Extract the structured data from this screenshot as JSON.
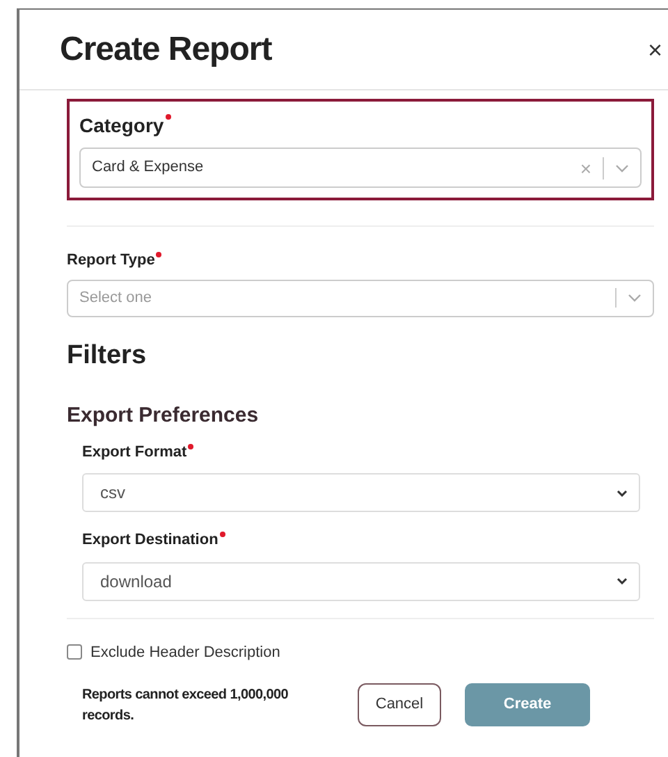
{
  "dialog": {
    "title": "Create Report",
    "close": "×"
  },
  "category": {
    "label": "Category",
    "required": true,
    "value": "Card & Expense",
    "clear": "×",
    "highlighted": true
  },
  "report_type": {
    "label": "Report Type",
    "required": true,
    "placeholder": "Select one"
  },
  "filters": {
    "title": "Filters"
  },
  "export_preferences": {
    "title": "Export Preferences",
    "fields": [
      {
        "label": "Export Format",
        "required": true,
        "value": "csv"
      },
      {
        "label": "Export Destination",
        "required": true,
        "value": "download"
      }
    ]
  },
  "exclude_header": {
    "label": "Exclude Header Description",
    "checked": false
  },
  "footer": {
    "note": "Reports cannot exceed 1,000,000 records.",
    "buttons": [
      {
        "label": "Cancel",
        "kind": "secondary"
      },
      {
        "label": "Create",
        "kind": "primary"
      }
    ]
  }
}
